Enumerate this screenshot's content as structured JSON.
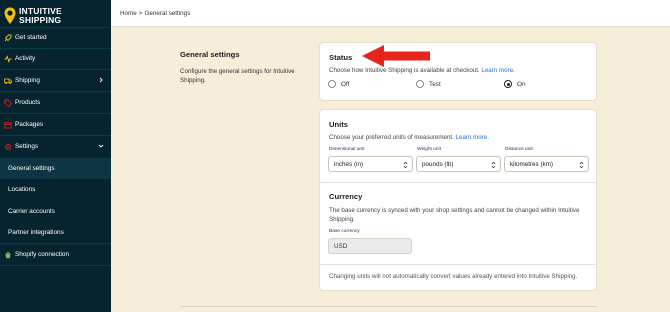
{
  "brand": {
    "name": "INTUITIVE\nSHIPPING"
  },
  "sidebar": {
    "items": [
      {
        "label": "Get started",
        "icon": "rocket-icon"
      },
      {
        "label": "Activity",
        "icon": "activity-icon"
      },
      {
        "label": "Shipping",
        "icon": "truck-icon"
      },
      {
        "label": "Products",
        "icon": "tag-icon"
      },
      {
        "label": "Packages",
        "icon": "package-icon"
      },
      {
        "label": "Settings",
        "icon": "gear-icon"
      },
      {
        "label": "General settings"
      },
      {
        "label": "Locations"
      },
      {
        "label": "Carrier accounts"
      },
      {
        "label": "Partner integrations"
      },
      {
        "label": "Shopify connection",
        "icon": "shopify-icon"
      }
    ]
  },
  "breadcrumb": {
    "home": "Home",
    "separator": ">",
    "current": "General settings"
  },
  "section": {
    "title": "General settings",
    "description": "Configure the general settings for Intuitive Shipping."
  },
  "status": {
    "title": "Status",
    "description": "Choose how Intuitive Shipping is available at checkout.",
    "link": "Learn more.",
    "options": [
      "Off",
      "Test",
      "On"
    ],
    "selected": "On"
  },
  "units": {
    "title": "Units",
    "description": "Choose your preferred units of measurement.",
    "link": "Learn more.",
    "dimensional": {
      "label": "Dimensional unit",
      "value": "inches (in)"
    },
    "weight": {
      "label": "Weight unit",
      "value": "pounds (lb)"
    },
    "distance": {
      "label": "Distance unit",
      "value": "kilometres (km)"
    }
  },
  "currency": {
    "title": "Currency",
    "description": "The base currency is synced with your shop settings and cannot be changed within Intuitive Shipping.",
    "label": "Base currency",
    "value": "USD"
  },
  "footer_note": "Changing units will not automatically convert values already entered into Intuitive Shipping.",
  "colors": {
    "sidebar_bg": "#062430",
    "page_bg": "#f6eed9",
    "link": "#1f6fd1",
    "arrow": "#e8231c",
    "logo": "#f4c20d"
  }
}
